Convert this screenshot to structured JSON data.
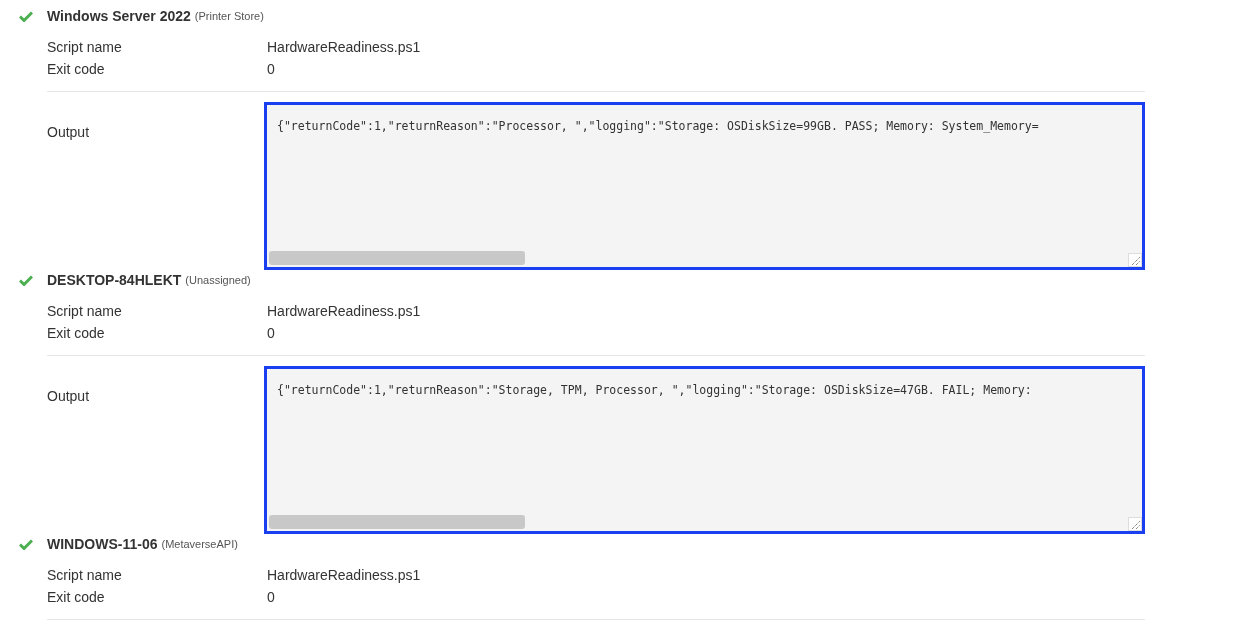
{
  "devices": [
    {
      "name": "Windows Server 2022",
      "scope": "(Printer Store)",
      "succeeded": true,
      "details": [
        {
          "label": "Script name",
          "value": "HardwareReadiness.ps1"
        },
        {
          "label": "Exit code",
          "value": "0"
        }
      ],
      "output": {
        "label": "Output",
        "value": "{\"returnCode\":1,\"returnReason\":\"Processor, \",\"logging\":\"Storage: OSDiskSize=99GB. PASS; Memory: System_Memory="
      }
    },
    {
      "name": "DESKTOP-84HLEKT",
      "scope": "(Unassigned)",
      "succeeded": true,
      "details": [
        {
          "label": "Script name",
          "value": "HardwareReadiness.ps1"
        },
        {
          "label": "Exit code",
          "value": "0"
        }
      ],
      "output": {
        "label": "Output",
        "value": "{\"returnCode\":1,\"returnReason\":\"Storage, TPM, Processor, \",\"logging\":\"Storage: OSDiskSize=47GB. FAIL; Memory:"
      }
    },
    {
      "name": "WINDOWS-11-06",
      "scope": "(MetaverseAPI)",
      "succeeded": true,
      "details": [
        {
          "label": "Script name",
          "value": "HardwareReadiness.ps1"
        },
        {
          "label": "Exit code",
          "value": "0"
        }
      ]
    }
  ]
}
